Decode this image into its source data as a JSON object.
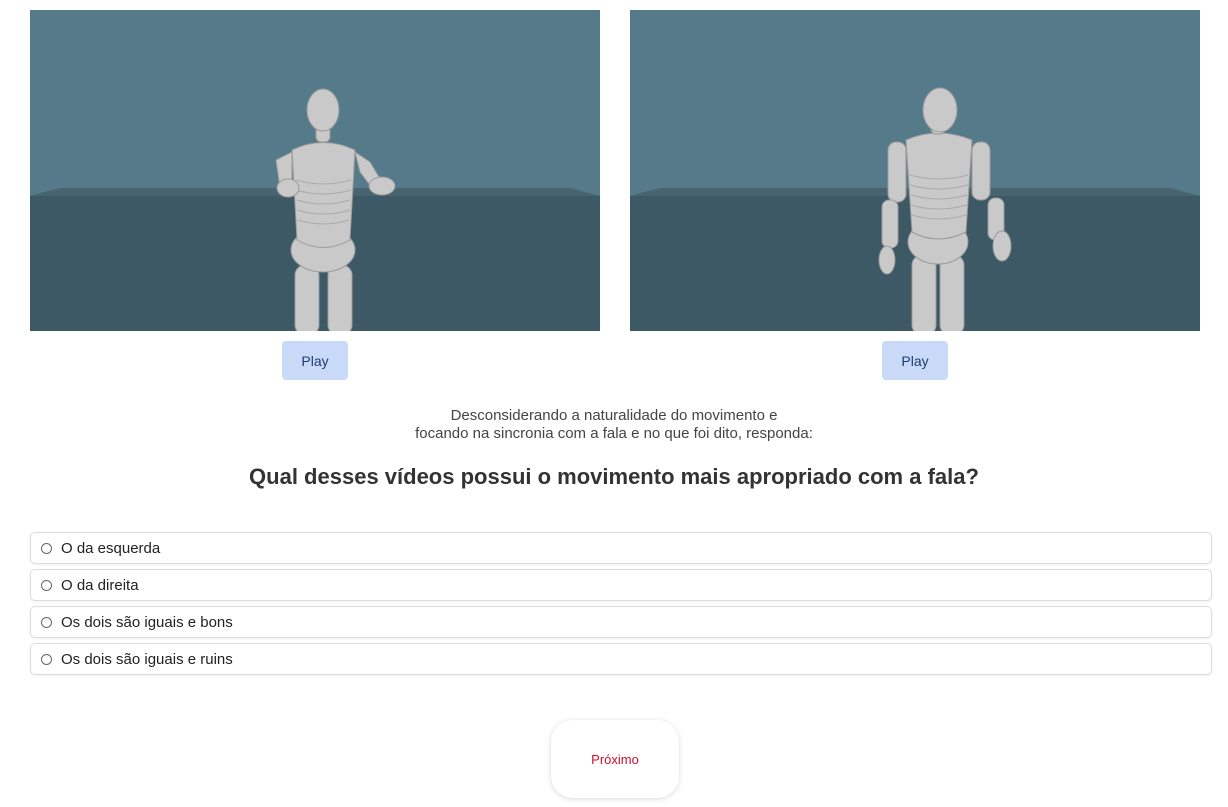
{
  "videos": [
    {
      "id": "left",
      "play_label": "Play"
    },
    {
      "id": "right",
      "play_label": "Play"
    }
  ],
  "instructions": {
    "line1": "Desconsiderando a naturalidade do movimento e",
    "line2": "focando na sincronia com a fala e no que foi dito, responda:"
  },
  "question": "Qual desses vídeos possui o movimento mais apropriado com a fala?",
  "options": [
    {
      "label": "O da esquerda",
      "selected": false
    },
    {
      "label": "O da direita",
      "selected": false
    },
    {
      "label": "Os dois são iguais e bons",
      "selected": false
    },
    {
      "label": "Os dois são iguais e ruins",
      "selected": false
    }
  ],
  "next_label": "Próximo",
  "colors": {
    "play_button_bg": "#c9daf8",
    "next_text": "#c8102e",
    "scene_wall": "#557a8a",
    "scene_floor": "#3d5966"
  }
}
